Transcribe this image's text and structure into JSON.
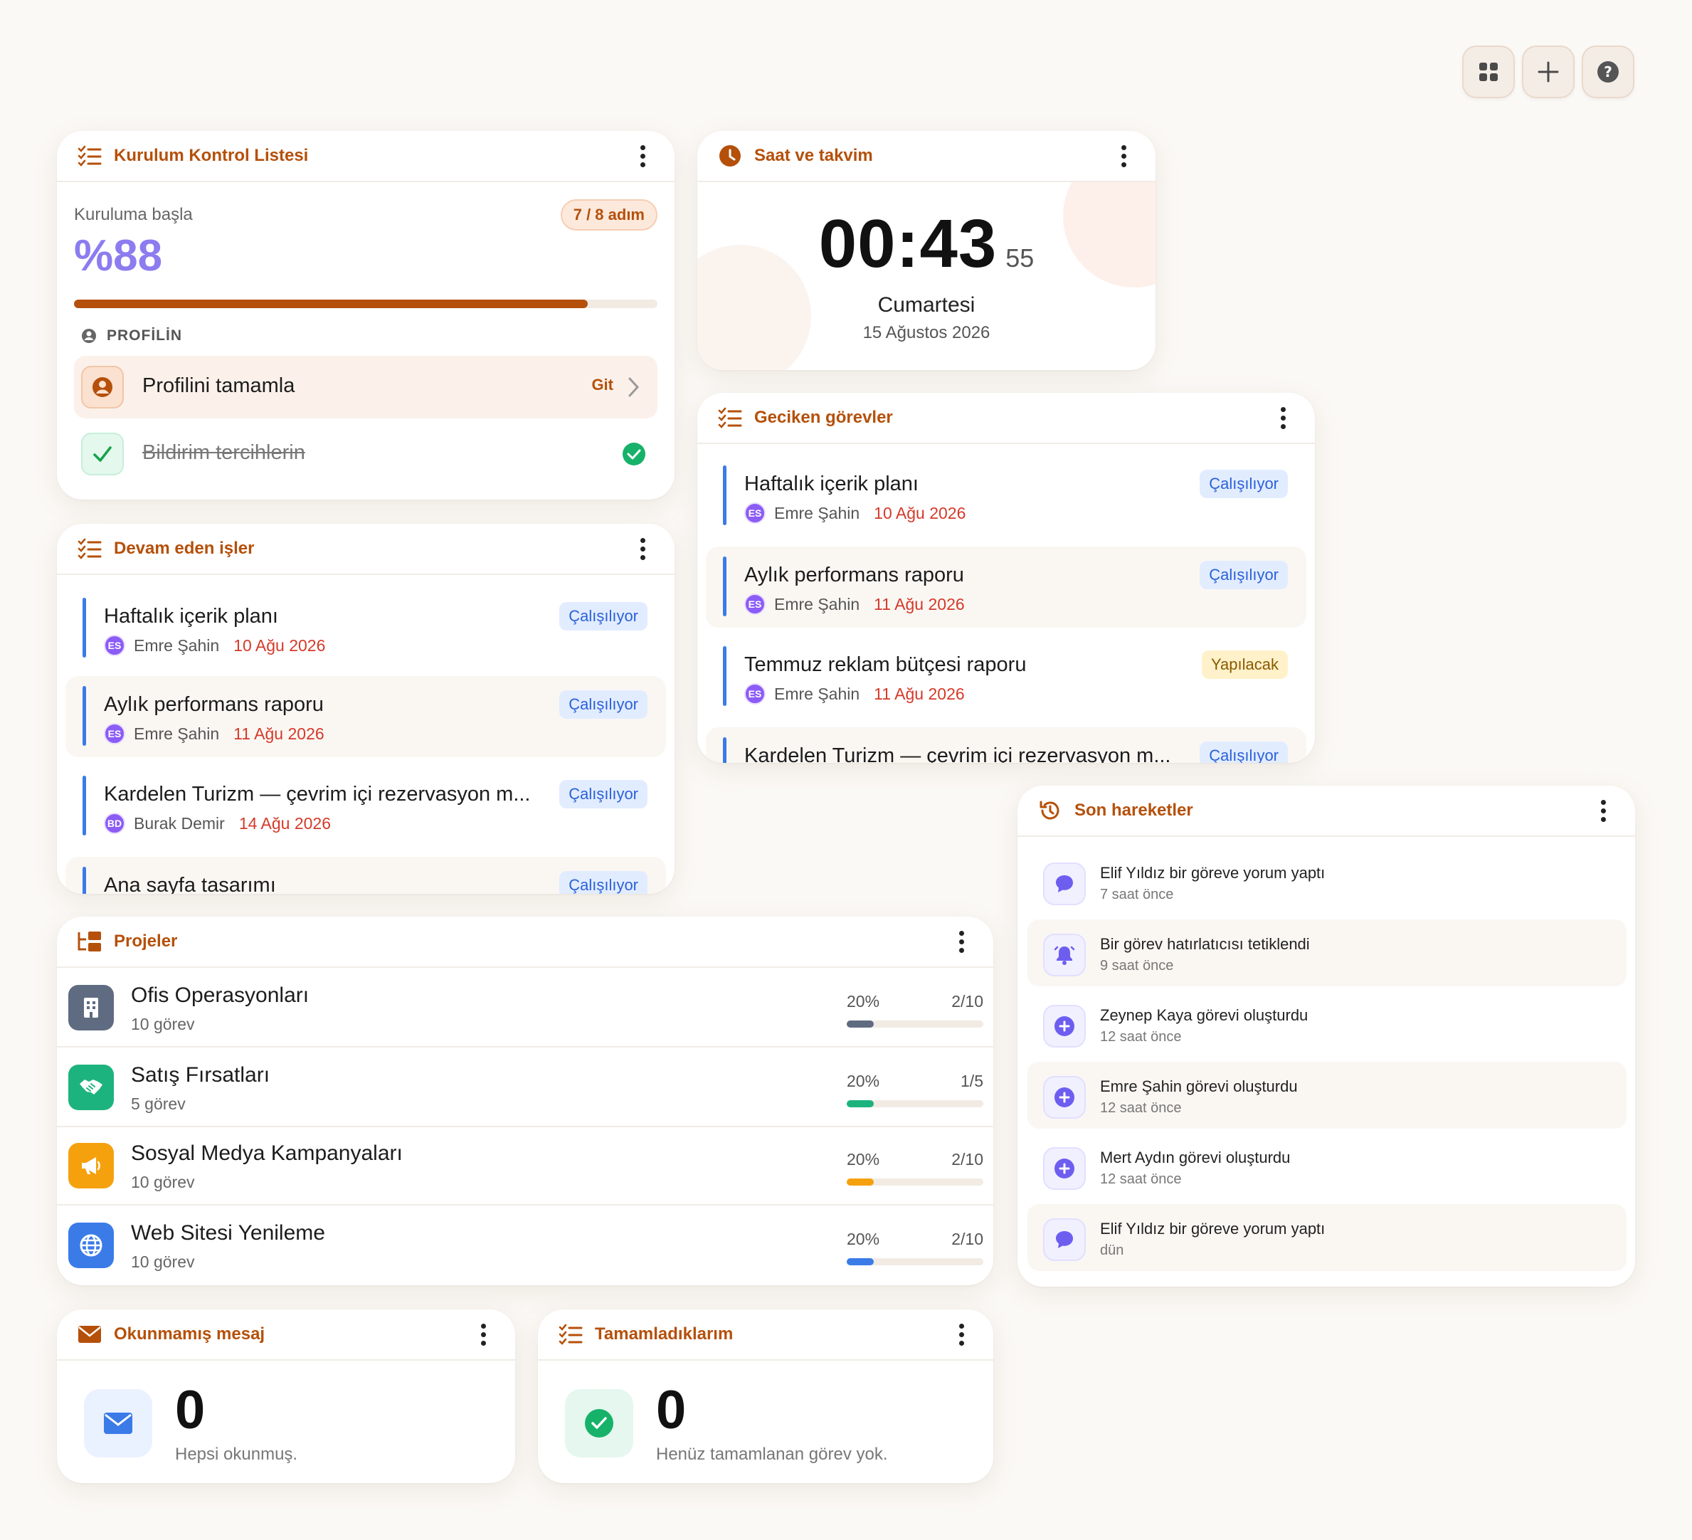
{
  "toolbar": {
    "buttons": [
      "grid-icon",
      "plus-icon",
      "help-icon"
    ]
  },
  "checklist": {
    "title": "Kurulum Kontrol Listesi",
    "start_label": "Kuruluma başla",
    "step_badge": "7 / 8 adım",
    "percent_text": "%88",
    "progress": 0.88,
    "section_label": "PROFİLİN",
    "items": [
      {
        "label": "Profilini tamamla",
        "action": "Git",
        "done": false
      },
      {
        "label": "Bildirim tercihlerin",
        "done": true
      }
    ]
  },
  "clock": {
    "title": "Saat ve takvim",
    "time": "00:43",
    "seconds": "55",
    "day": "Cumartesi",
    "date": "15 Ağustos 2026"
  },
  "overdue": {
    "title": "Geciken görevler",
    "tasks": [
      {
        "name": "Haftalık içerik planı",
        "status": "Çalışılıyor",
        "initials": "ES",
        "person": "Emre Şahin",
        "date": "10 Ağu 2026"
      },
      {
        "name": "Aylık performans raporu",
        "status": "Çalışılıyor",
        "initials": "ES",
        "person": "Emre Şahin",
        "date": "11 Ağu 2026"
      },
      {
        "name": "Temmuz reklam bütçesi raporu",
        "status": "Yapılacak",
        "initials": "ES",
        "person": "Emre Şahin",
        "date": "11 Ağu 2026"
      },
      {
        "name": "Kardelen Turizm — çevrim içi rezervasyon m...",
        "status": "Çalışılıyor"
      }
    ]
  },
  "inprogress": {
    "title": "Devam eden işler",
    "tasks": [
      {
        "name": "Haftalık içerik planı",
        "status": "Çalışılıyor",
        "initials": "ES",
        "person": "Emre Şahin",
        "date": "10 Ağu 2026"
      },
      {
        "name": "Aylık performans raporu",
        "status": "Çalışılıyor",
        "initials": "ES",
        "person": "Emre Şahin",
        "date": "11 Ağu 2026"
      },
      {
        "name": "Kardelen Turizm — çevrim içi rezervasyon m...",
        "status": "Çalışılıyor",
        "initials": "BD",
        "person": "Burak Demir",
        "date": "14 Ağu 2026"
      },
      {
        "name": "Ana sayfa tasarımı",
        "status": "Çalışılıyor"
      }
    ]
  },
  "activity": {
    "title": "Son hareketler",
    "items": [
      {
        "icon": "comment-icon",
        "text": "Elif Yıldız bir göreve yorum yaptı",
        "time": "7 saat önce"
      },
      {
        "icon": "bell-icon",
        "text": "Bir görev hatırlatıcısı tetiklendi",
        "time": "9 saat önce"
      },
      {
        "icon": "plus-circle-icon",
        "text": "Zeynep Kaya görevi oluşturdu",
        "time": "12 saat önce"
      },
      {
        "icon": "plus-circle-icon",
        "text": "Emre Şahin görevi oluşturdu",
        "time": "12 saat önce"
      },
      {
        "icon": "plus-circle-icon",
        "text": "Mert Aydın görevi oluşturdu",
        "time": "12 saat önce"
      },
      {
        "icon": "comment-icon",
        "text": "Elif Yıldız bir göreve yorum yaptı",
        "time": "dün"
      }
    ]
  },
  "projects": {
    "title": "Projeler",
    "items": [
      {
        "name": "Ofis Operasyonları",
        "count": "10 görev",
        "percent": "20%",
        "fraction": "2/10",
        "progress": 0.2,
        "color": "#5f6b80",
        "icon": "building-icon"
      },
      {
        "name": "Satış Fırsatları",
        "count": "5 görev",
        "percent": "20%",
        "fraction": "1/5",
        "progress": 0.2,
        "color": "#1db37e",
        "icon": "handshake-icon"
      },
      {
        "name": "Sosyal Medya Kampanyaları",
        "count": "10 görev",
        "percent": "20%",
        "fraction": "2/10",
        "progress": 0.2,
        "color": "#f5a10e",
        "icon": "megaphone-icon"
      },
      {
        "name": "Web Sitesi Yenileme",
        "count": "10 görev",
        "percent": "20%",
        "fraction": "2/10",
        "progress": 0.2,
        "color": "#3b7be8",
        "icon": "globe-icon"
      }
    ]
  },
  "unread": {
    "title": "Okunmamış mesaj",
    "value": "0",
    "caption": "Hepsi okunmuş."
  },
  "completed": {
    "title": "Tamamladıklarım",
    "value": "0",
    "caption": "Henüz tamamlanan görev yok."
  },
  "colors": {
    "accent": "#b5500a",
    "primary_purple": "#8b7cf0",
    "task_bar": "#3b7be8",
    "date_red": "#d43a2a",
    "success": "#16a34a"
  }
}
